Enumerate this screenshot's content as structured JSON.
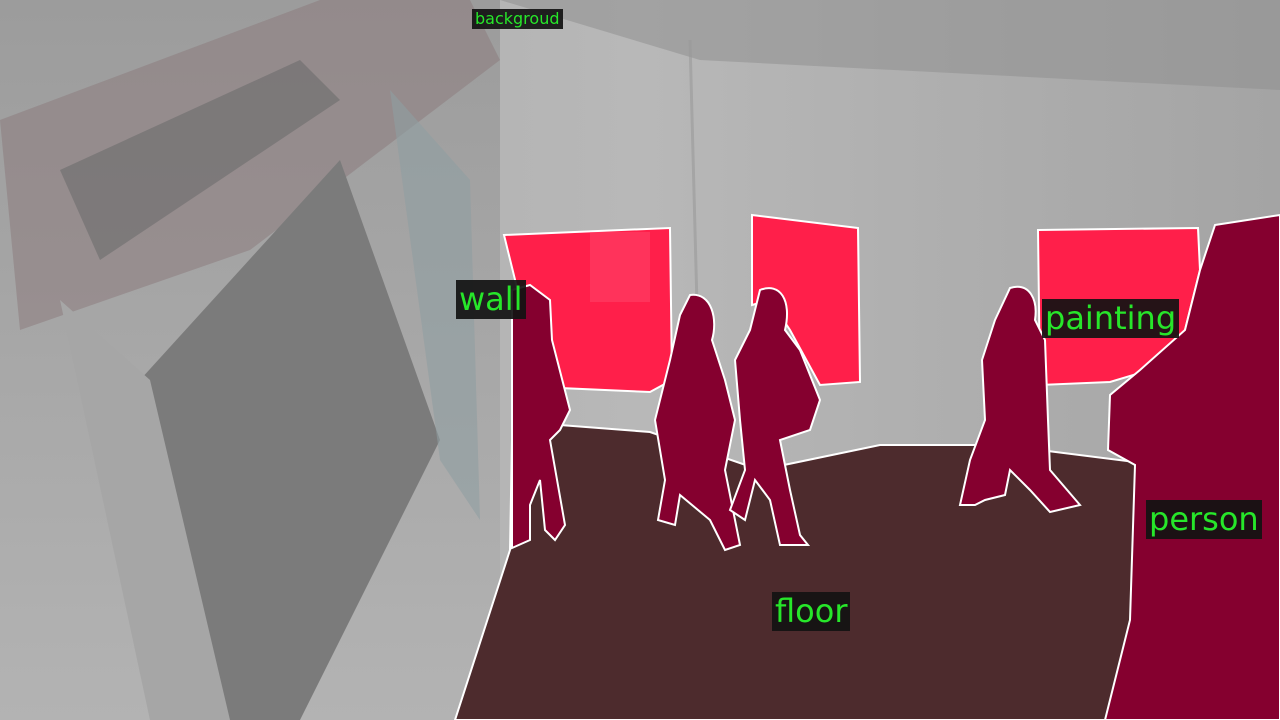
{
  "segmentation": {
    "label_color": "#27e62a",
    "outline_color": "#ffffff",
    "classes": [
      {
        "label": "backgroud",
        "color": "#9a9a9a"
      },
      {
        "label": "wall",
        "color": "#c2c2c2"
      },
      {
        "label": "painting",
        "color": "#ff1f4a"
      },
      {
        "label": "person",
        "color": "#85002f"
      },
      {
        "label": "floor",
        "color": "#4d2b2d"
      }
    ]
  }
}
